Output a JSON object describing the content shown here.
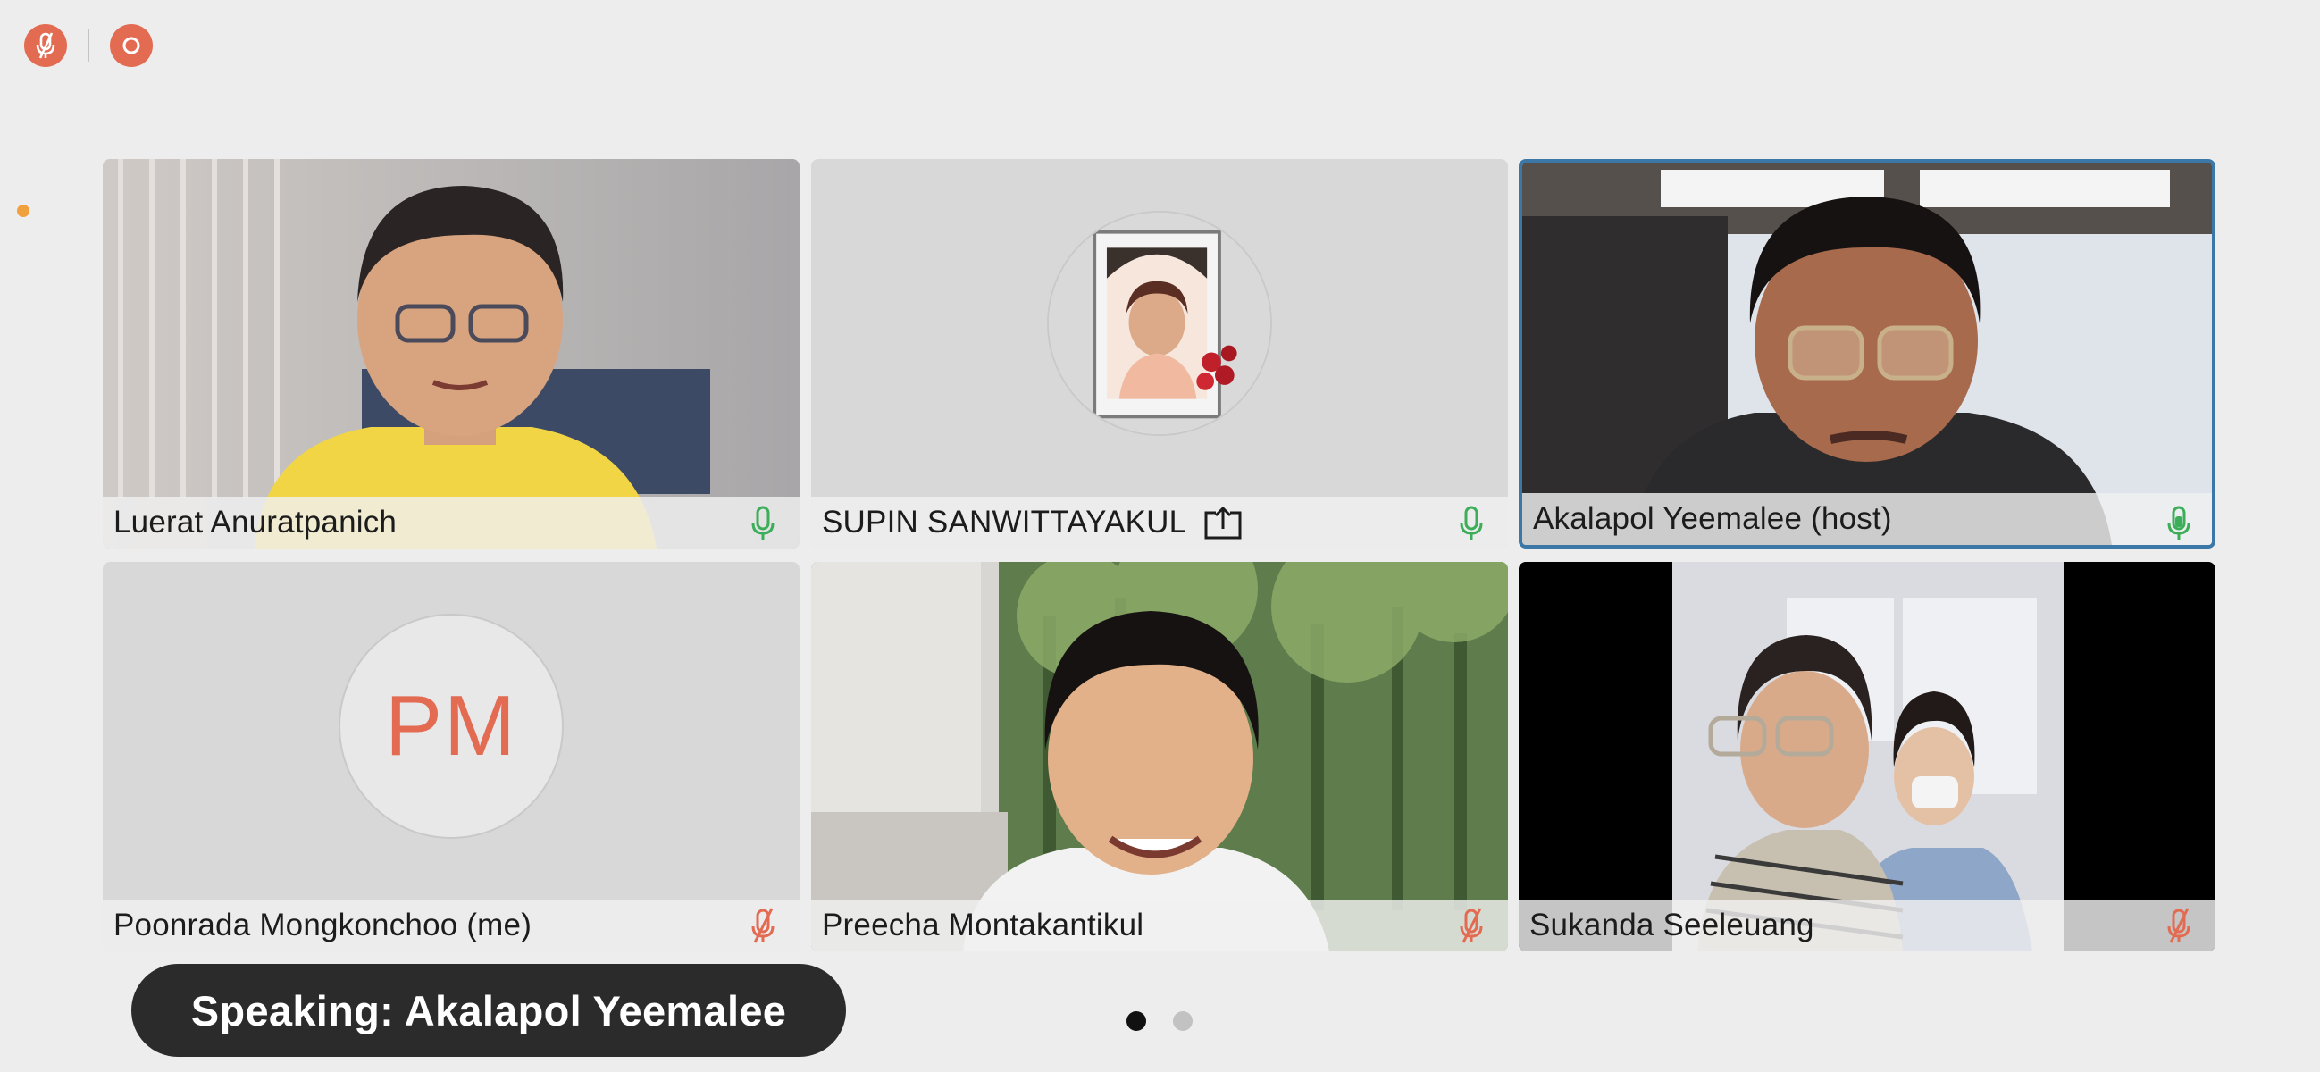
{
  "controls": {
    "mute_icon": "microphone-muted-icon",
    "record_icon": "record-icon",
    "accent": "#e26b52"
  },
  "participants": [
    {
      "name": "Luerat Anuratpanich",
      "mic": "on",
      "video": "camera",
      "sharing": false,
      "active": false
    },
    {
      "name": "SUPIN SANWITTAYAKUL",
      "mic": "on",
      "video": "photo-avatar",
      "sharing": true,
      "active": false
    },
    {
      "name": "Akalapol Yeemalee (host)",
      "mic": "speaking",
      "video": "camera",
      "sharing": false,
      "active": true
    },
    {
      "name": "Poonrada Mongkonchoo (me)",
      "mic": "muted",
      "video": "initials",
      "initials": "PM",
      "sharing": false,
      "active": false
    },
    {
      "name": "Preecha Montakantikul",
      "mic": "muted",
      "video": "camera",
      "sharing": false,
      "active": false
    },
    {
      "name": "Sukanda Seeleuang",
      "mic": "muted",
      "video": "camera",
      "sharing": false,
      "active": false
    }
  ],
  "speaking": {
    "label": "Speaking: Akalapol Yeemalee"
  },
  "pagination": {
    "current": 1,
    "total": 2
  },
  "colors": {
    "mic_on": "#3cae5a",
    "mic_muted": "#e26b52",
    "active_border": "#3b78a8",
    "background": "#ededed"
  }
}
